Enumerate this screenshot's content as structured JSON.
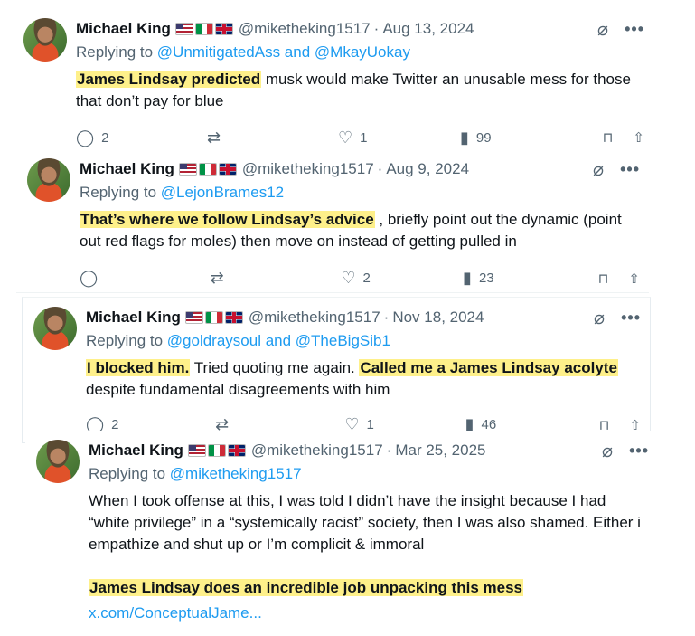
{
  "tweets": [
    {
      "name": "Michael King",
      "handle": "@miketheking1517",
      "sep": "·",
      "date": "Aug 13, 2024",
      "replying_prefix": "Replying to ",
      "replying_to": "@UnmitigatedAss and @MkayUokay",
      "body_hl1": "James Lindsay predicted",
      "body_rest": " musk would make Twitter an unusable mess for those that don’t pay for blue",
      "replies": "2",
      "likes": "1",
      "views": "99"
    },
    {
      "name": "Michael King",
      "handle": "@miketheking1517",
      "sep": "·",
      "date": "Aug 9, 2024",
      "replying_prefix": "Replying to ",
      "replying_to": "@LejonBrames12",
      "body_hl1": "That’s where we follow Lindsay’s advice",
      "body_rest": " , briefly point out the dynamic (point out red flags for moles) then move on instead of getting pulled in",
      "replies": "",
      "likes": "2",
      "views": "23"
    },
    {
      "name": "Michael King",
      "handle": "@miketheking1517",
      "sep": "·",
      "date": "Nov 18, 2024",
      "replying_prefix": "Replying to ",
      "replying_to": "@goldraysoul and @TheBigSib1",
      "body_hl1": "I blocked him.",
      "body_mid": " Tried quoting me again. ",
      "body_hl2": "Called me a James Lindsay acolyte",
      "body_rest": " despite fundamental disagreements with him",
      "replies": "2",
      "likes": "1",
      "views": "46"
    },
    {
      "name": "Michael King",
      "handle": "@miketheking1517",
      "sep": "·",
      "date": "Mar 25, 2025",
      "replying_prefix": "Replying to ",
      "replying_to": "@miketheking1517",
      "body_p1": "When I took offense at this, I was told I didn’t have the insight because I had “white privilege” in a “systemically racist” society, then I was also shamed. Either i empathize and shut up or I’m complicit & immoral",
      "body_hl1": "James Lindsay does an incredible job unpacking this mess",
      "link": "x.com/ConceptualJame..."
    }
  ],
  "icons": {
    "grok": "⌀",
    "more": "•••",
    "reply": "◯",
    "retweet": "⇄",
    "like": "♡",
    "views": "▮",
    "bookmark": "⊓",
    "share": "⇧"
  },
  "colors": {
    "accent": "#1d9bf0",
    "highlight": "#fef08a",
    "muted": "#536471"
  }
}
